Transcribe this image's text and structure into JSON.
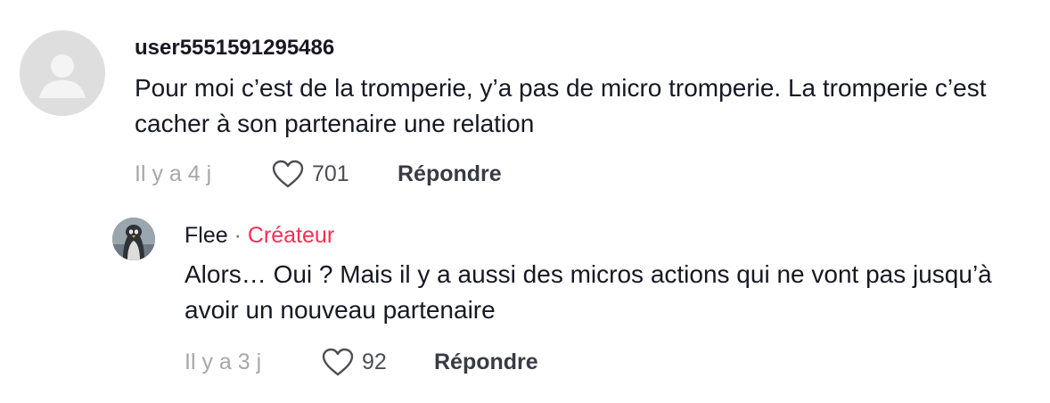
{
  "comments": [
    {
      "username": "user5551591295486",
      "text": "Pour moi c’est de la tromperie, y’a pas de micro tromperie. La tromperie c’est cacher à son partenaire une relation",
      "time": "Il y a 4 j",
      "likes": "701",
      "reply_label": "Répondre",
      "avatar_icon": "default-avatar-icon"
    },
    {
      "username": "Flee",
      "separator": "·",
      "badge": "Créateur",
      "badge_color": "#fe2c55",
      "text": "Alors… Oui ? Mais il y a aussi des micros actions qui ne vont pas jusqu’à avoir un nouveau partenaire",
      "time": "Il y a 3 j",
      "likes": "92",
      "reply_label": "Répondre",
      "avatar_icon": "penguin-avatar-icon"
    }
  ]
}
